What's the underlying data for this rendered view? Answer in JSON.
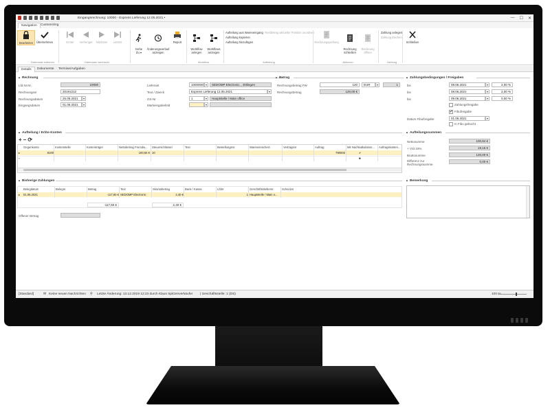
{
  "window": {
    "title": "Eingangsrechnung: 10000 - Express Lieferung 12.05.2021 •",
    "controls": [
      "—",
      "☐",
      "✕"
    ]
  },
  "menu_tabs": [
    "Navigation",
    "Customizing"
  ],
  "ribbon": {
    "bearbeiten": "Bearbeiten",
    "uebernehmen": "Übernehmen",
    "erster": "Erster",
    "vorheriger": "Vorheriger",
    "naechster": "Nächster",
    "letzter": "Letzter",
    "gehe_zu": "Gehe\nZu ▾",
    "aenderungsverlauf": "Änderungsverlauf\nanzeigen",
    "report": "Report",
    "workflow_anlegen": "Workflow\nanlegen",
    "workflows_anzeigen": "Workflows\nanzeigen",
    "aufteilung_items": [
      "Aufteilung aus Wareneingang",
      "Aufteilung kopieren",
      "Aufteilung hinzufügen"
    ],
    "aufteilung_disabled": "Restbetrag aktueller Position zuordnen",
    "rechnungspruefung": "Rechnungsprüfung",
    "rechnung_schliessen": "Rechnung\nschließen",
    "rechnung_oeffnen": "Rechnung\nöffnen",
    "zahlung_anlegen": "Zahlung anlegen",
    "zahlung_loeschen": "Zahlung löschen",
    "schliessen": "Schließen",
    "groups": {
      "datensatz": "Datensatz editieren",
      "datensatz_wechseln": "Datensatz wechseln",
      "workflow": "Workflow",
      "aufteilung": "Aufteilung",
      "aktionen": "Aktionen",
      "zahlung": "Zahlung"
    }
  },
  "doc_tabs": [
    "Details",
    "Dokumente",
    "Termine/Aufgaben"
  ],
  "rechnung": {
    "title": "Rechnung",
    "labels": {
      "lfdnr": "Lfd.Nr.Nr.",
      "rechnungsnr": "Rechnungsnr",
      "rechnungsdatum": "Rechnungsdatum",
      "eingangsdatum": "Eingangsdatum",
      "lieferant": "Lieferant",
      "text": "Text / Zweck",
      "gs": "GS-Nr",
      "markeingabe": "Markeingabefeld"
    },
    "values": {
      "lfdnr": "10000",
      "rechnungsnr": "20191212",
      "rechnungsdatum": "25.05.2021",
      "eingangsdatum": "01.06.2021",
      "lieferant_nr": "100000084",
      "lieferant_name": "SEDOMP Electronic, , Ettlingen",
      "text": "Express Lieferung 12.05.2021",
      "gs_nr": "1",
      "gs_name": "Hauptstelle / Main office"
    }
  },
  "betrag": {
    "title": "Betrag",
    "labels": {
      "fw": "Rechnungsbetrag FW",
      "betrag": "Rechnungsbetrag"
    },
    "values": {
      "fw": "120",
      "currency": "EUR",
      "rate": "1",
      "betrag": "120,00 €"
    }
  },
  "zahlungsbedingungen": {
    "title": "Zahlungsbedingungen / Freigaben",
    "labels": {
      "bis": "bis",
      "datum_fibu": "Datum Fibufreigabe"
    },
    "rows": [
      {
        "date": "08.06.2021",
        "pct": "2,00 %"
      },
      {
        "date": "08.06.2021",
        "pct": "2,00 %"
      },
      {
        "date": "09.06.2021",
        "pct": "0,00 %"
      }
    ],
    "checks": [
      {
        "label": "Zahlungsfreigabe",
        "checked": ""
      },
      {
        "label": "Fibufreigabe",
        "checked": "✔"
      }
    ],
    "fibu_date": "01.06.2021",
    "in_fibu_label": "In Fibu gebucht"
  },
  "aufteilung": {
    "title": "Aufteilung / Erlös-Konten",
    "toolbar": [
      "+",
      "−",
      "⟳"
    ],
    "columns": [
      "Gegenkonto",
      "Kostenstelle",
      "Kostenträger",
      "Nettobetrag Fremdw...",
      "Steuerschlüssel",
      "Text",
      "Bestellungsnr.",
      "Wareneinschein",
      "Vertragsnr",
      "Auftrag",
      "Mit Nachkalkulation...",
      "Auftragskosten..."
    ],
    "row": {
      "gegenkonto": "8100",
      "netto": "100,84 €",
      "steuer": "10",
      "auftrag": "790002",
      "nachkalk": "✔"
    }
  },
  "summen": {
    "title": "Aufteilungssummen",
    "labels": {
      "netto": "Nettosumme",
      "vst": "+ VSt 19%",
      "brutto": "Bruttosumme",
      "diff": "Differenz zur Rechnungssumme"
    },
    "values": {
      "netto": "100,84 €",
      "vst": "19,16 €",
      "brutto": "120,00 €",
      "diff": "0,00 €"
    }
  },
  "zahlungen": {
    "title": "Bisherige Zahlungen",
    "columns": [
      "Belegdatum",
      "Belegnr",
      "Betrag",
      "Text",
      "Skontobetrag",
      "Bank / Kasse",
      "Lfdnr",
      "Geschäftsstellennr.",
      "Schecknr"
    ],
    "row": {
      "belegdatum": "01.06.2021",
      "betrag": "-117,60 €",
      "text": "SEDOMP Electronic",
      "skonto": "2,40 €",
      "lfdnr": "1",
      "gs": "Hauptstelle / Main o..."
    },
    "totals": {
      "betrag": "-117,60 €",
      "skonto": "2,40 €"
    },
    "offener_label": "Offener Betrag"
  },
  "bemerkung": {
    "title": "Bemerkung"
  },
  "status": {
    "mode": "[Standard]",
    "messages": "Keine neuen Nachrichten",
    "last_change": "Letzte Änderung: 13.12.2019 12:23 durch Klaus Spitzenverkäufer",
    "gs": "| Geschäftsstelle: 1 (DS)",
    "zoom": "100 %"
  },
  "colors": {
    "accent": "#f2c46a",
    "selected_row": "#fdf0c3",
    "readonly": "#dedede"
  }
}
